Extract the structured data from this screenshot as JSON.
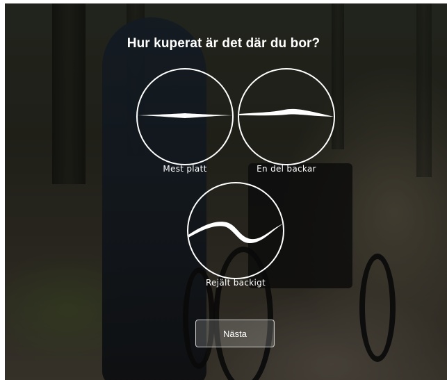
{
  "question": {
    "title": "Hur kuperat är det där du bor?"
  },
  "options": [
    {
      "label": "Mest platt",
      "icon": "flat-terrain-icon"
    },
    {
      "label": "En del backar",
      "icon": "gentle-hills-icon"
    },
    {
      "label": "Rejält backigt",
      "icon": "steep-hills-icon"
    }
  ],
  "actions": {
    "next_label": "Nästa"
  },
  "colors": {
    "text": "#ffffff",
    "ring": "#ffffff",
    "button_border": "#cfcfcf"
  }
}
